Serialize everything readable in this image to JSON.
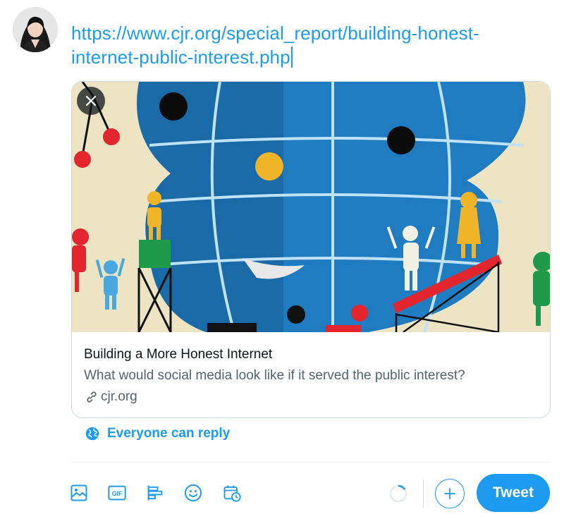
{
  "compose": {
    "text": "https://www.cjr.org/special_report/building-honest-internet-public-interest.php"
  },
  "link_card": {
    "title": "Building a More Honest Internet",
    "description": "What would social media look like if it served the public interest?",
    "domain": "cjr.org",
    "close_icon": "close-icon",
    "domain_icon": "link-icon"
  },
  "reply_setting": {
    "label": "Everyone can reply",
    "icon": "globe-icon"
  },
  "toolbar": {
    "icons": [
      "image-icon",
      "gif-icon",
      "poll-icon",
      "emoji-icon",
      "schedule-icon"
    ],
    "gif_label": "GIF",
    "tweet_label": "Tweet"
  },
  "colors": {
    "accent": "#1d9bf0",
    "text_primary": "#0f1419",
    "text_secondary": "#536471",
    "border": "#cfd9de"
  }
}
